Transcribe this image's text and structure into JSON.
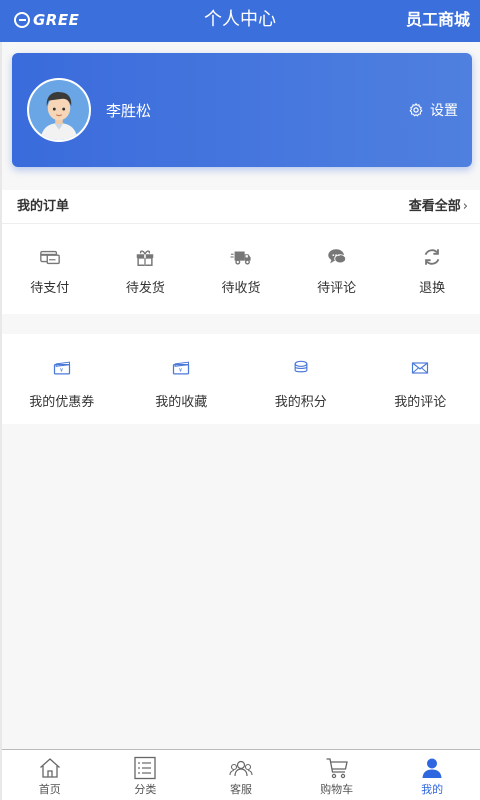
{
  "header": {
    "logo_text": "GREE",
    "title": "个人中心",
    "right_label": "员工商城"
  },
  "profile": {
    "username": "李胜松",
    "settings_label": "设置"
  },
  "orders": {
    "title": "我的订单",
    "view_all": "查看全部",
    "items": [
      {
        "label": "待支付",
        "icon": "card-icon"
      },
      {
        "label": "待发货",
        "icon": "gift-icon"
      },
      {
        "label": "待收货",
        "icon": "truck-icon"
      },
      {
        "label": "待评论",
        "icon": "chat-icon"
      },
      {
        "label": "退换",
        "icon": "refresh-icon"
      }
    ]
  },
  "services": {
    "items": [
      {
        "label": "我的优惠券",
        "icon": "coupon-icon"
      },
      {
        "label": "我的收藏",
        "icon": "favorites-icon"
      },
      {
        "label": "我的积分",
        "icon": "coins-icon"
      },
      {
        "label": "我的评论",
        "icon": "mail-icon"
      }
    ]
  },
  "nav": {
    "tabs": [
      {
        "label": "首页",
        "icon": "home-icon"
      },
      {
        "label": "分类",
        "icon": "list-icon"
      },
      {
        "label": "客服",
        "icon": "customer-service-icon"
      },
      {
        "label": "购物车",
        "icon": "cart-icon"
      },
      {
        "label": "我的",
        "icon": "user-icon"
      }
    ],
    "active": "我的"
  },
  "colors": {
    "primary": "#3b6fdc",
    "active_tab": "#2f67e0",
    "icon_gray": "#777777",
    "icon_blue": "#4a78d8"
  }
}
